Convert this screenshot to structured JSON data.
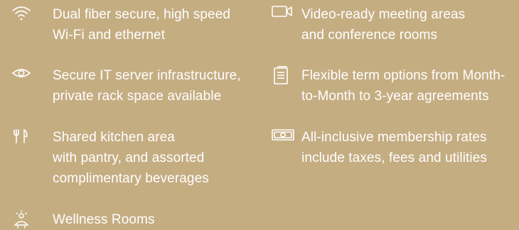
{
  "accent_color": "#c5ad82",
  "text_color": "#ffffff",
  "left_column": [
    {
      "icon": "wifi-icon",
      "lines": [
        "Dual fiber secure, high speed",
        "Wi-Fi and ethernet"
      ]
    },
    {
      "icon": "eye-icon",
      "lines": [
        "Secure IT server infrastructure,",
        "private rack space available"
      ]
    },
    {
      "icon": "fork-knife-icon",
      "lines": [
        "Shared kitchen area",
        "with pantry, and assorted",
        "complimentary beverages"
      ]
    },
    {
      "icon": "wellness-icon",
      "lines": [
        "Wellness Rooms"
      ]
    }
  ],
  "right_column": [
    {
      "icon": "video-camera-icon",
      "lines": [
        "Video-ready meeting areas",
        "and conference rooms"
      ]
    },
    {
      "icon": "document-icon",
      "lines": [
        "Flexible term options from Month-",
        "to-Month to 3-year agreements"
      ]
    },
    {
      "icon": "cash-icon",
      "lines": [
        "All-inclusive membership rates",
        "include taxes, fees and utilities"
      ]
    }
  ]
}
